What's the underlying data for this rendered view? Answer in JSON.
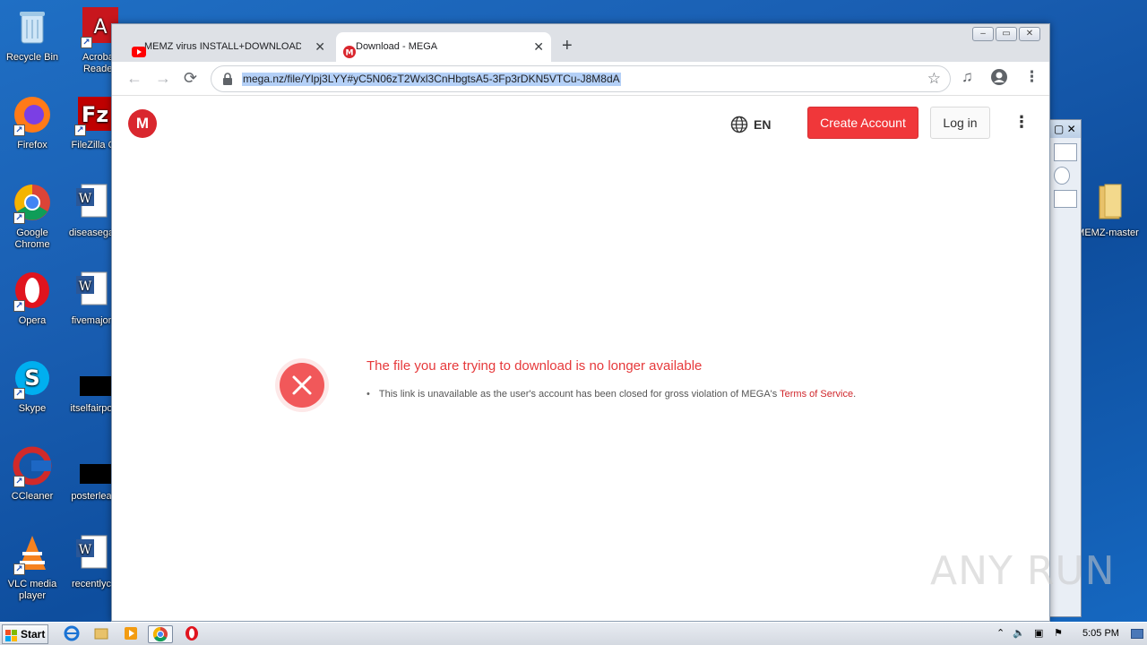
{
  "desktop": {
    "icons": [
      {
        "label": "Recycle Bin",
        "icon": "recycle-bin-icon"
      },
      {
        "label": "Acrobat Reader",
        "icon": "acrobat-icon"
      },
      {
        "label": "Firefox",
        "icon": "firefox-icon"
      },
      {
        "label": "FileZilla C",
        "icon": "filezilla-icon"
      },
      {
        "label": "Google Chrome",
        "icon": "chrome-icon"
      },
      {
        "label": "diseasega",
        "icon": "word-doc-icon"
      },
      {
        "label": "Opera",
        "icon": "opera-icon"
      },
      {
        "label": "fivemajor",
        "icon": "word-doc-icon"
      },
      {
        "label": "Skype",
        "icon": "skype-icon"
      },
      {
        "label": "itselfairpo",
        "icon": "black-file-icon"
      },
      {
        "label": "CCleaner",
        "icon": "ccleaner-icon"
      },
      {
        "label": "posterlea",
        "icon": "black-file-icon"
      },
      {
        "label": "VLC media player",
        "icon": "vlc-icon"
      },
      {
        "label": "recentlyc",
        "icon": "word-doc-icon"
      },
      {
        "label": "MEMZ-master",
        "icon": "folder-icon"
      }
    ]
  },
  "browser": {
    "tabs": [
      {
        "title": "MEMZ virus INSTALL+DOWNLOAD (c",
        "favicon": "youtube-icon",
        "active": false
      },
      {
        "title": "Download - MEGA",
        "favicon": "mega-icon",
        "active": true
      }
    ],
    "new_tab": "+",
    "window_buttons": {
      "minimize": "–",
      "restore": "▭",
      "close": "✕"
    },
    "url": "mega.nz/file/Ylpj3LYY#yC5N06zT2Wxl3CnHbgtsA5-3Fp3rDKN5VTCu-J8M8dA",
    "nav": {
      "back": "←",
      "forward": "→",
      "reload": "⟳"
    }
  },
  "mega": {
    "logo": "M",
    "language": "EN",
    "create_account": "Create Account",
    "login": "Log in",
    "menu": "⋮",
    "error_title": "The file you are trying to download is no longer available",
    "error_detail": "This link is unavailable as the user's account has been closed for gross violation of MEGA's ",
    "tos_link": "Terms of Service",
    "tos_suffix": ".",
    "colors": {
      "accent": "#f0373a",
      "logo": "#d9272e",
      "error": "#e6393b"
    }
  },
  "taskbar": {
    "start": "Start",
    "clock": "5:05 PM",
    "apps": [
      "ie-icon",
      "explorer-icon",
      "media-player-icon",
      "chrome-icon",
      "opera-icon"
    ]
  },
  "watermark": "ANY RUN"
}
